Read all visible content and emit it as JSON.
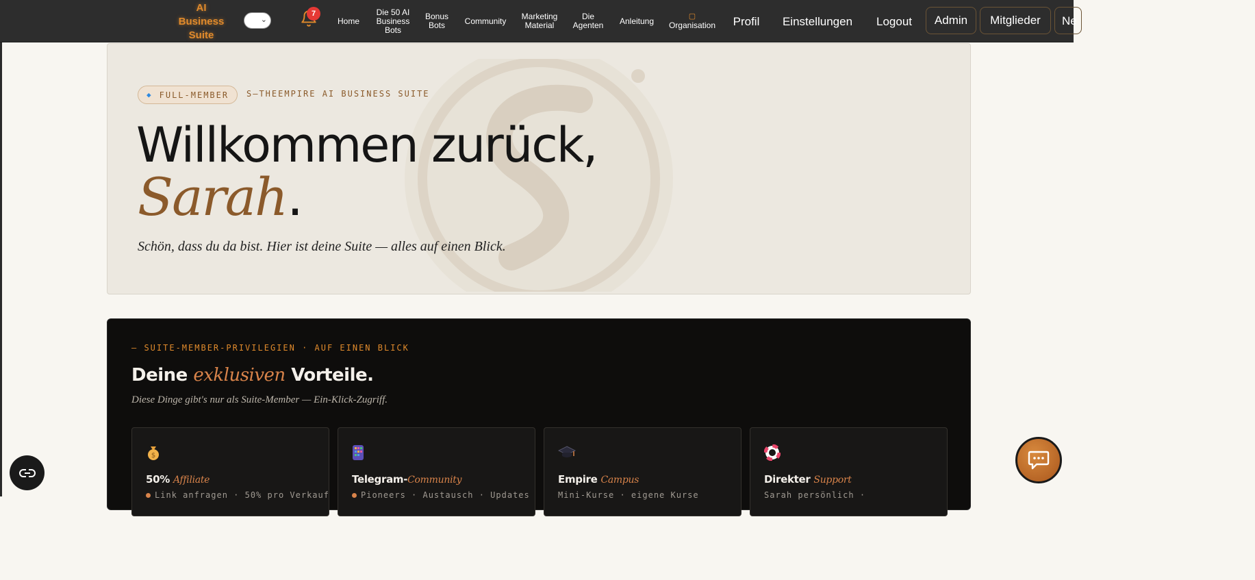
{
  "nav": {
    "brand": [
      "AI",
      "Business",
      "Suite"
    ],
    "notification_count": "7",
    "items": [
      [
        "Home"
      ],
      [
        "Die 50 AI",
        "Business",
        "Bots"
      ],
      [
        "Bonus",
        "Bots"
      ],
      [
        "Community"
      ],
      [
        "Marketing",
        "Material"
      ],
      [
        "Die",
        "Agenten"
      ],
      [
        "Anleitung"
      ],
      [
        "Organisation"
      ]
    ],
    "links_large": [
      "Profil",
      "Einstellungen",
      "Logout"
    ],
    "buttons": [
      "Admin",
      "Mitglieder"
    ],
    "overflow_label": "Ne"
  },
  "hero": {
    "badge": "FULL-MEMBER",
    "suite_label": "S—THEEMPIRE AI BUSINESS SUITE",
    "title": "Willkommen zurück,",
    "name": "Sarah",
    "dot": ".",
    "subtitle": "Schön, dass du da bist. Hier ist deine Suite — alles auf einen Blick."
  },
  "perks": {
    "eyebrow": "— SUITE-MEMBER-PRIVILEGIEN · AUF EINEN BLICK",
    "title_pre": "Deine ",
    "title_accent": "exklusiven",
    "title_post": " Vorteile.",
    "subtitle": "Diese Dinge gibt's nur als Suite-Member — Ein-Klick-Zugriff.",
    "cards": [
      {
        "icon": "money-bag-icon",
        "title": "50%",
        "title_it": "Affiliate",
        "desc": "Link anfragen · 50% pro Verkauf"
      },
      {
        "icon": "phone-icon",
        "title": "Telegram-",
        "title_it": "Community",
        "desc": "Pioneers · Austausch · Updates"
      },
      {
        "icon": "graduation-cap-icon",
        "title": "Empire ",
        "title_it": "Campus",
        "desc": "Mini-Kurse · eigene Kurse"
      },
      {
        "icon": "lifebuoy-icon",
        "title": "Direkter ",
        "title_it": "Support",
        "desc": "Sarah persönlich ·"
      }
    ]
  },
  "colors": {
    "accent": "#d8834a",
    "brand_orange": "#e08a2c",
    "badge_red": "#e53935",
    "dark_bg": "#0e0d0c",
    "hero_bg": "#ece8e0"
  }
}
